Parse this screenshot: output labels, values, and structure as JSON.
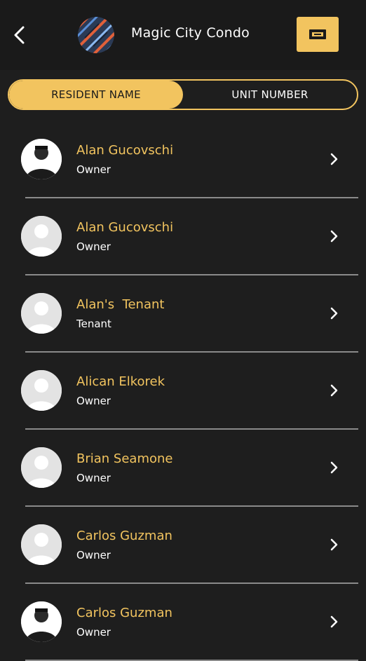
{
  "header": {
    "title": "Magic City Condo",
    "back_icon": "chevron-left-icon",
    "menu_icon": "menu-card-icon"
  },
  "toggle": {
    "resident_label": "RESIDENT NAME",
    "unit_label": "UNIT NUMBER",
    "selected": "RESIDENT NAME"
  },
  "residents": [
    {
      "name": "Alan Gucovschi",
      "role": "Owner",
      "avatar": "photo"
    },
    {
      "name": "Alan Gucovschi",
      "role": "Owner",
      "avatar": "placeholder"
    },
    {
      "name": "Alan's  Tenant",
      "role": "Tenant",
      "avatar": "placeholder"
    },
    {
      "name": "Alican Elkorek",
      "role": "Owner",
      "avatar": "placeholder"
    },
    {
      "name": "Brian Seamone",
      "role": "Owner",
      "avatar": "placeholder"
    },
    {
      "name": "Carlos Guzman",
      "role": "Owner",
      "avatar": "placeholder"
    },
    {
      "name": "Carlos Guzman",
      "role": "Owner",
      "avatar": "photo"
    }
  ],
  "colors": {
    "accent": "#f2c45f",
    "background": "#1e1e1e",
    "header": "#1a1a1a",
    "divider": "#8a8a8a"
  }
}
